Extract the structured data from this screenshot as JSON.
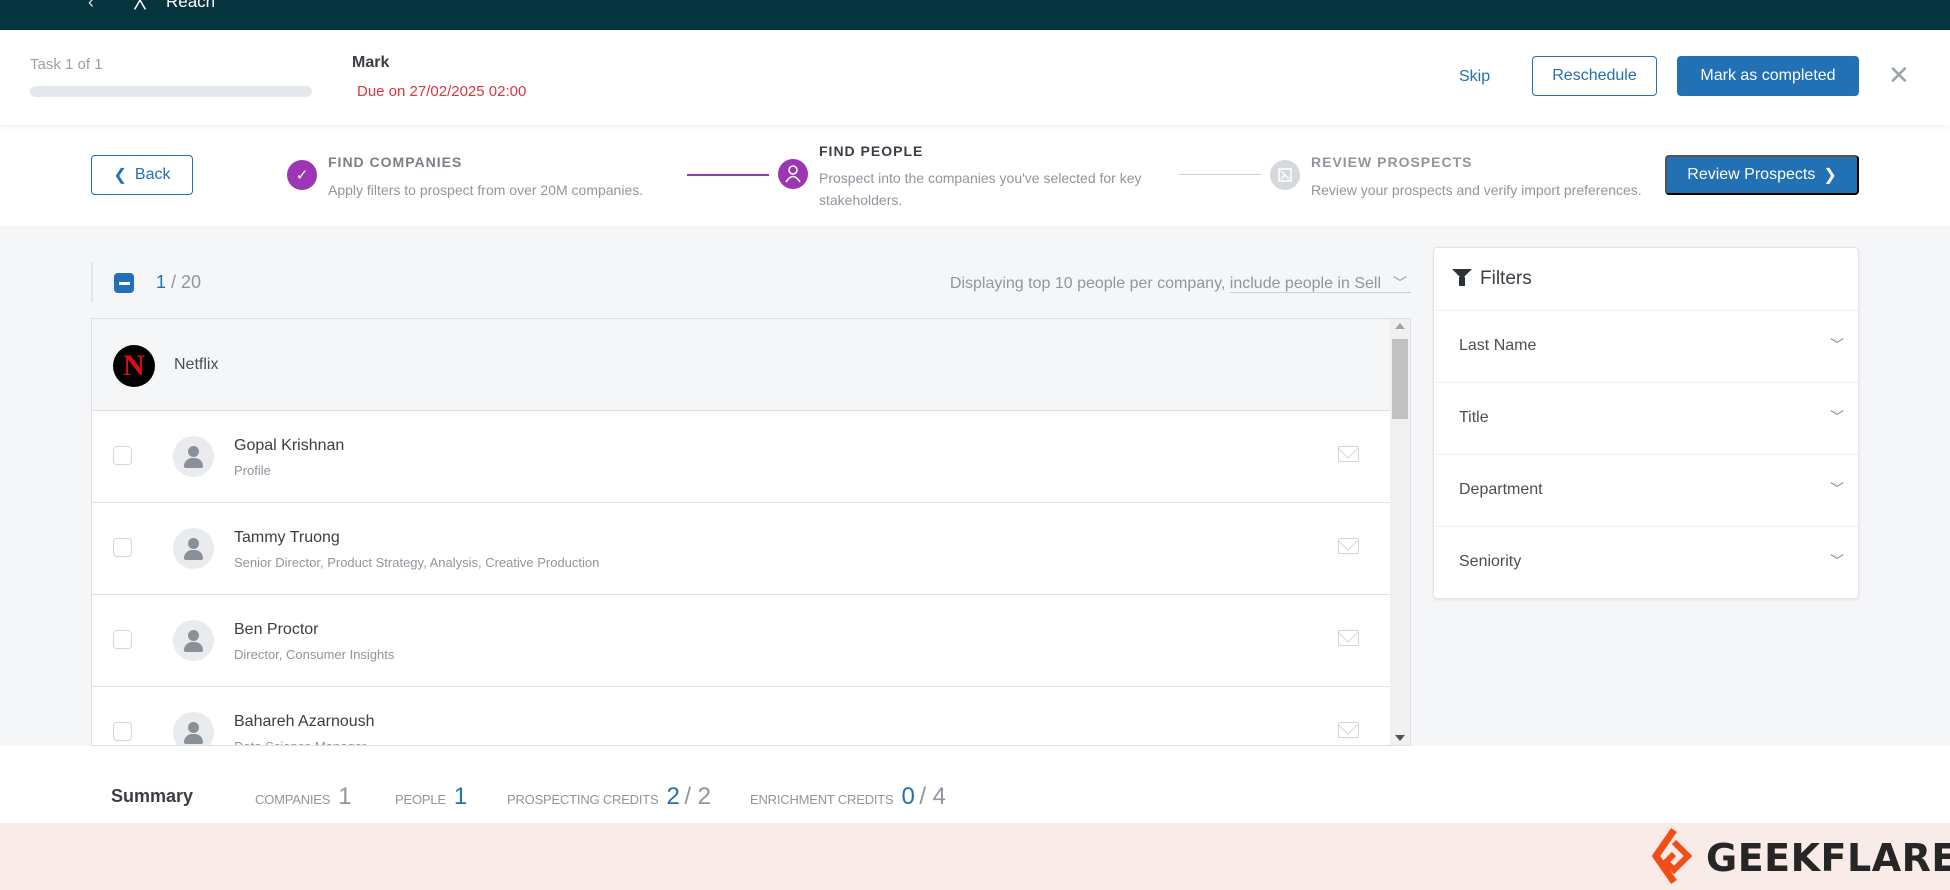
{
  "topbar": {
    "app_name": "Reach",
    "back_icon": "chevron-left-icon",
    "app_icon": "reach-logo-icon"
  },
  "task": {
    "count_label": "Task 1 of 1",
    "progress_percent": 0,
    "name": "Mark",
    "due": "Due on 27/02/2025 02:00",
    "skip_label": "Skip",
    "reschedule_label": "Reschedule",
    "complete_label": "Mark as completed",
    "close_icon": "close-icon"
  },
  "stepper": {
    "back_label": "Back",
    "steps": [
      {
        "title": "FIND COMPANIES",
        "desc": "Apply filters to prospect from over 20M companies.",
        "state": "completed",
        "icon": "check-icon"
      },
      {
        "title": "FIND PEOPLE",
        "desc": "Prospect into the companies you've selected for key stakeholders.",
        "state": "active",
        "icon": "person-icon"
      },
      {
        "title": "REVIEW PROSPECTS",
        "desc": "Review your prospects and verify import preferences.",
        "state": "pending",
        "icon": "review-icon"
      }
    ],
    "review_button_label": "Review Prospects"
  },
  "list": {
    "selected": "1",
    "total": "/ 20",
    "display_note": "Displaying top 10 people per company,",
    "include_option": "include people in Sell",
    "company": {
      "name": "Netflix",
      "logo_letter": "N"
    },
    "people": [
      {
        "name": "Gopal Krishnan",
        "title": "Profile",
        "checked": false
      },
      {
        "name": "Tammy Truong",
        "title": "Senior Director, Product Strategy, Analysis, Creative Production",
        "checked": false
      },
      {
        "name": "Ben Proctor",
        "title": "Director, Consumer Insights",
        "checked": false
      },
      {
        "name": "Bahareh Azarnoush",
        "title": "Data Science Manager",
        "checked": false
      }
    ]
  },
  "filters": {
    "title": "Filters",
    "items": [
      "Last Name",
      "Title",
      "Department",
      "Seniority"
    ]
  },
  "summary": {
    "title": "Summary",
    "companies_label": "COMPANIES",
    "companies_value": "1",
    "people_label": "PEOPLE",
    "people_value": "1",
    "prospecting_label": "PROSPECTING CREDITS",
    "prospecting_used": "2",
    "prospecting_total": "/ 2",
    "enrichment_label": "ENRICHMENT CREDITS",
    "enrichment_used": "0",
    "enrichment_total": "/ 4"
  },
  "watermark": {
    "text": "GEEKFLARE",
    "color": "#f04e14"
  },
  "colors": {
    "primary": "#2271b5",
    "step_active": "#9c36b5",
    "due_red": "#d9363e",
    "topbar": "#06353f"
  }
}
